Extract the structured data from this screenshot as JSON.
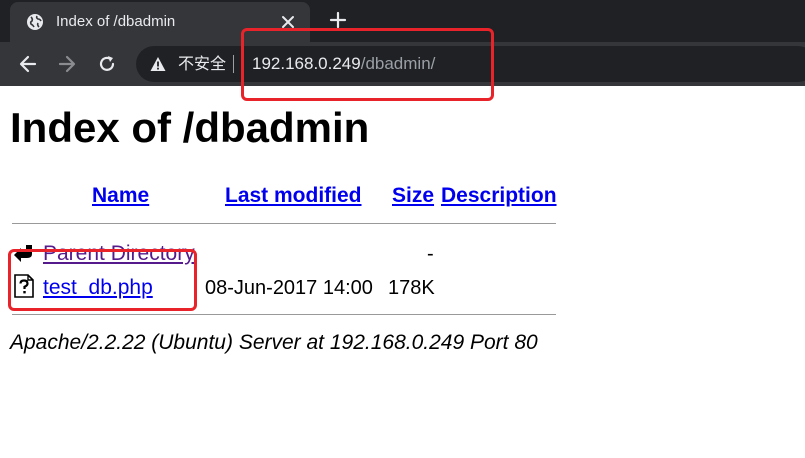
{
  "browser": {
    "tab": {
      "title": "Index of /dbadmin",
      "favicon": "globe-icon",
      "close_icon": "close-icon"
    },
    "new_tab_icon": "plus-icon",
    "nav": {
      "back_icon": "arrow-left-icon",
      "forward_icon": "arrow-right-icon",
      "reload_icon": "reload-icon"
    },
    "omnibox": {
      "security_icon": "warning-triangle-icon",
      "security_label": "不安全",
      "url_host": "192.168.0.249",
      "url_path": "/dbadmin/"
    },
    "colors": {
      "chrome_dark": "#202124",
      "chrome_toolbar": "#35363a",
      "link": "#0000ee",
      "visited_link": "#551a8b",
      "annotation": "#e8232a"
    }
  },
  "page": {
    "title": "Index of /dbadmin",
    "table": {
      "headers": {
        "name": "Name",
        "last_modified": "Last modified",
        "size": "Size",
        "description": "Description"
      },
      "rows": [
        {
          "icon": "back-arrow-icon",
          "name": "Parent Directory",
          "last_modified": "",
          "size": "-",
          "description": ""
        },
        {
          "icon": "unknown-file-icon",
          "name": "test_db.php",
          "last_modified": "08-Jun-2017 14:00",
          "size": "178K",
          "description": ""
        }
      ]
    },
    "address": "Apache/2.2.22 (Ubuntu) Server at 192.168.0.249 Port 80"
  }
}
